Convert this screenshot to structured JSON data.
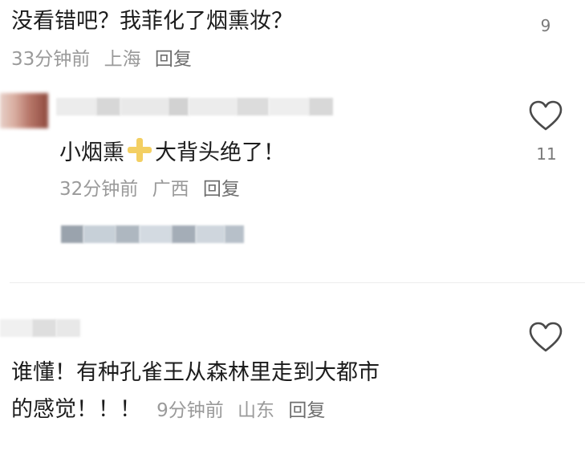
{
  "comments": [
    {
      "text": "没看错吧？我菲化了烟熏妆？",
      "time": "33分钟前",
      "location": "上海",
      "reply": "回复",
      "likes": "9"
    },
    {
      "text_before": "小烟熏",
      "text_after": "大背头绝了！",
      "time": "32分钟前",
      "location": "广西",
      "reply": "回复",
      "likes": "11"
    },
    {
      "text_line1": "谁懂！有种孔雀王从森林里走到大都市",
      "text_line2": "的感觉！！！",
      "time": "9分钟前",
      "location": "山东",
      "reply": "回复"
    }
  ],
  "icons": {
    "heart": "heart-outline-icon",
    "plus_emoji": "yellow-plus-emoji"
  },
  "colors": {
    "meta_gray": "#9a9a9a",
    "heart_stroke": "#4a4a4a",
    "emoji_yellow": "#f3cf62"
  }
}
